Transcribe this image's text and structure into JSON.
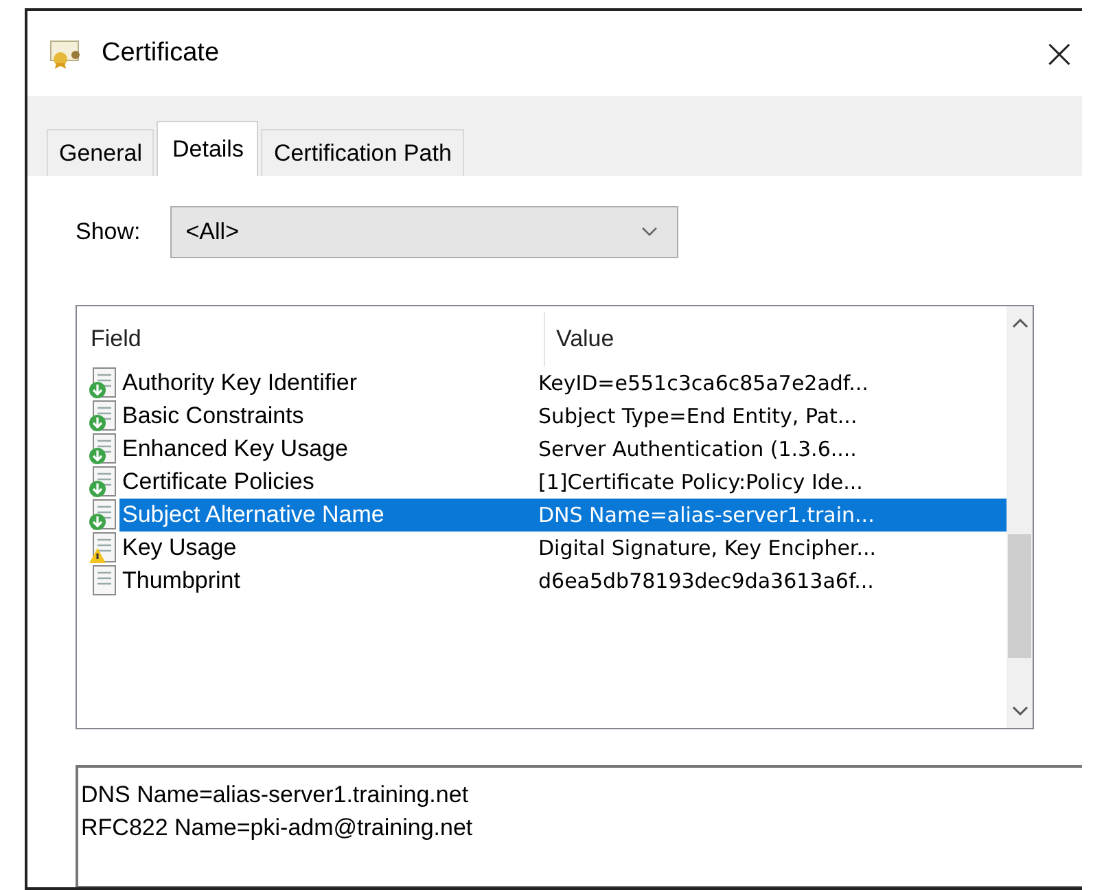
{
  "window": {
    "title": "Certificate",
    "close": "×"
  },
  "tabs": [
    {
      "label": "General",
      "selected": false
    },
    {
      "label": "Details",
      "selected": true
    },
    {
      "label": "Certification Path",
      "selected": false
    }
  ],
  "show": {
    "label": "Show:",
    "value": "<All>"
  },
  "table": {
    "columns": [
      "Field",
      "Value"
    ],
    "rows": [
      {
        "kind": "extension",
        "field": "Authority Key Identifier",
        "value": "KeyID=e551c3ca6c85a7e2adf...",
        "selected": false
      },
      {
        "kind": "extension",
        "field": "Basic Constraints",
        "value": "Subject Type=End Entity, Pat...",
        "selected": false
      },
      {
        "kind": "extension",
        "field": "Enhanced Key Usage",
        "value": "Server Authentication (1.3.6....",
        "selected": false
      },
      {
        "kind": "extension",
        "field": "Certificate Policies",
        "value": "[1]Certificate Policy:Policy Ide...",
        "selected": false
      },
      {
        "kind": "extension",
        "field": "Subject Alternative Name",
        "value": "DNS Name=alias-server1.train...",
        "selected": true
      },
      {
        "kind": "critical",
        "field": "Key Usage",
        "value": "Digital Signature, Key Encipher...",
        "selected": false
      },
      {
        "kind": "property",
        "field": "Thumbprint",
        "value": "d6ea5db78193dec9da3613a6f...",
        "selected": false
      }
    ]
  },
  "detail": {
    "lines": [
      "DNS Name=alias-server1.training.net",
      "RFC822 Name=pki-adm@training.net"
    ]
  }
}
